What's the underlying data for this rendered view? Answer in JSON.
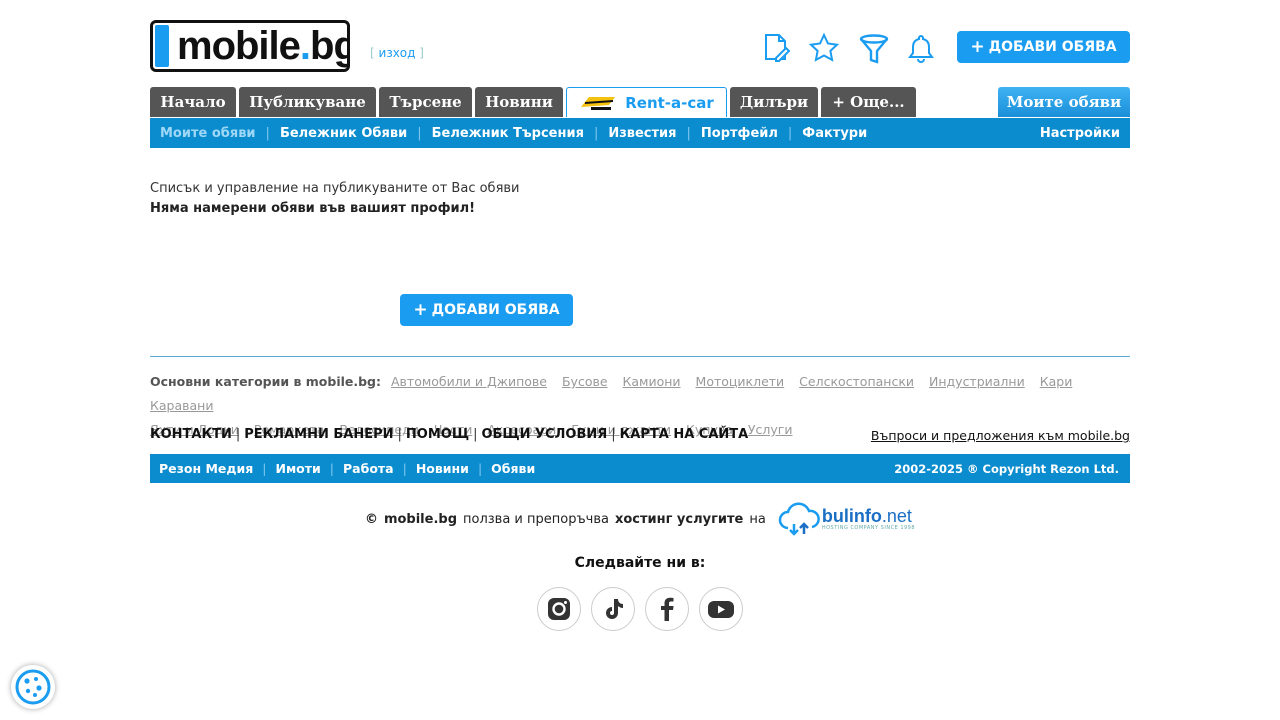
{
  "header": {
    "logo_text_main": "mobile",
    "logo_text_dot": ".",
    "logo_text_tld": "bg",
    "logout_open": "[",
    "logout_label": "изход",
    "logout_close": "]",
    "add_button_label": "ДОБАВИ ОБЯВА",
    "add_button_plus": "+",
    "icons": [
      "edit-document-icon",
      "star-icon",
      "filter-icon",
      "bell-icon"
    ]
  },
  "tabs": [
    {
      "label": "Начало"
    },
    {
      "label": "Публикуване"
    },
    {
      "label": "Търсене"
    },
    {
      "label": "Новини"
    },
    {
      "label": "Rent-a-car"
    },
    {
      "label": "Дилъри"
    },
    {
      "label": "+ Още..."
    },
    {
      "label": "Моите обяви"
    }
  ],
  "subnav": {
    "items": [
      "Моите обяви",
      "Бележник Обяви",
      "Бележник Търсения",
      "Известия",
      "Портфейл",
      "Фактури"
    ],
    "separator": "|",
    "settings": "Настройки"
  },
  "content": {
    "description": "Списък и управление на публикуваните от Вас обяви",
    "empty_message": "Няма намерени обяви във вашият профил!",
    "add_button_label": "ДОБАВИ ОБЯВА",
    "add_button_plus": "+"
  },
  "categories": {
    "label": "Основни категории в mobile.bg:",
    "items": [
      "Автомобили и Джипове",
      "Бусове",
      "Камиони",
      "Мотоциклети",
      "Селскостопански",
      "Индустриални",
      "Кари",
      "Каравани",
      "Яхти и Лодки",
      "Ремаркета",
      "Велосипеди",
      "Части",
      "Аксесоари",
      "Гуми и джанти",
      "Купува",
      "Услуги"
    ]
  },
  "footer_links": {
    "items": [
      "КОНТАКТИ",
      "РЕКЛАМНИ БАНЕРИ",
      "ПОМОЩ",
      "ОБЩИ УСЛОВИЯ",
      "КАРТА НА САЙТА"
    ],
    "separator": "|",
    "feedback": "Въпроси и предложения към mobile.bg"
  },
  "bottom_bar": {
    "items": [
      "Резон Медия",
      "Имоти",
      "Работа",
      "Новини",
      "Обяви"
    ],
    "separator": "|",
    "copyright": "2002-2025 ® Copyright Rezon Ltd."
  },
  "hosting": {
    "copy_sign": "©",
    "site": "mobile.bg",
    "text_middle": "ползва и препоръчва",
    "text_bold": "хостинг услугите",
    "text_on": "на",
    "brand_name": "bulinfo",
    "brand_tld": ".net",
    "brand_tagline": "HOSTING COMPANY SINCE 1998"
  },
  "social": {
    "title": "Следвайте ни в:",
    "icons": [
      "instagram-icon",
      "tiktok-icon",
      "facebook-icon",
      "youtube-icon"
    ]
  },
  "colors": {
    "accent": "#1a9cf0",
    "nav_bar": "#0a8ccf",
    "tab_bg": "#555555"
  }
}
